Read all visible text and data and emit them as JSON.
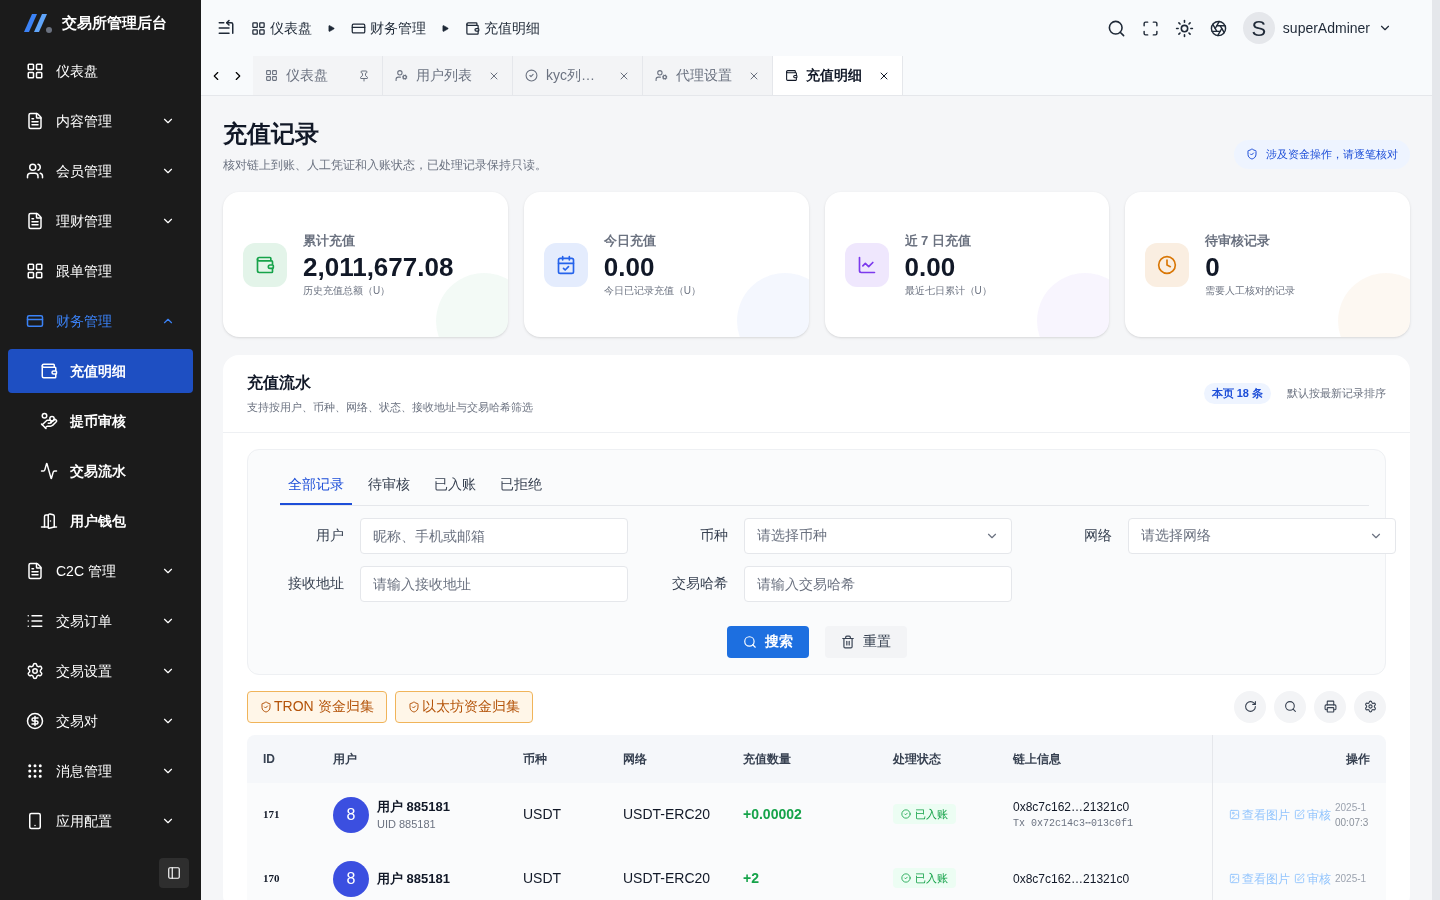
{
  "brand": {
    "title": "交易所管理后台"
  },
  "sidebar": {
    "items": [
      {
        "label": "仪表盘",
        "kind": "link",
        "selected": false
      },
      {
        "label": "内容管理",
        "kind": "group",
        "expanded": false,
        "selected": false
      },
      {
        "label": "会员管理",
        "kind": "group",
        "expanded": false,
        "selected": false
      },
      {
        "label": "理财管理",
        "kind": "group",
        "expanded": false,
        "selected": false
      },
      {
        "label": "跟单管理",
        "kind": "link",
        "selected": false
      },
      {
        "label": "财务管理",
        "kind": "group",
        "expanded": true,
        "selected": true,
        "children": [
          {
            "label": "充值明细",
            "selected": true
          },
          {
            "label": "提币审核",
            "selected": false
          },
          {
            "label": "交易流水",
            "selected": false
          },
          {
            "label": "用户钱包",
            "selected": false
          }
        ]
      },
      {
        "label": "C2C 管理",
        "kind": "group",
        "expanded": false,
        "selected": false
      },
      {
        "label": "交易订单",
        "kind": "group",
        "expanded": false,
        "selected": false
      },
      {
        "label": "交易设置",
        "kind": "group",
        "expanded": false,
        "selected": false
      },
      {
        "label": "交易对",
        "kind": "group",
        "expanded": false,
        "selected": false
      },
      {
        "label": "消息管理",
        "kind": "group",
        "expanded": false,
        "selected": false
      },
      {
        "label": "应用配置",
        "kind": "group",
        "expanded": false,
        "selected": false
      }
    ]
  },
  "breadcrumb": [
    {
      "label": "仪表盘"
    },
    {
      "label": "财务管理"
    },
    {
      "label": "充值明细"
    }
  ],
  "user": {
    "avatar": "S",
    "name": "superAdminer"
  },
  "tabs": [
    {
      "label": "仪表盘",
      "pinned": true,
      "selected": false
    },
    {
      "label": "用户列表",
      "pinned": false,
      "selected": false
    },
    {
      "label": "kyc列…",
      "pinned": false,
      "selected": false
    },
    {
      "label": "代理设置",
      "pinned": false,
      "selected": false
    },
    {
      "label": "充值明细",
      "pinned": false,
      "selected": true
    }
  ],
  "page": {
    "title": "充值记录",
    "subtitle": "核对链上到账、人工凭证和入账状态，已处理记录保持只读。",
    "notice": "涉及资金操作，请逐笔核对"
  },
  "stats": [
    {
      "label": "累计充值",
      "value": "2,011,677.08",
      "caption": "历史充值总额（U）",
      "color": "#16a34a"
    },
    {
      "label": "今日充值",
      "value": "0.00",
      "caption": "今日已记录充值（U）",
      "color": "#2563eb"
    },
    {
      "label": "近 7 日充值",
      "value": "0.00",
      "caption": "最近七日累计（U）",
      "color": "#7c3aed"
    },
    {
      "label": "待审核记录",
      "value": "0",
      "caption": "需要人工核对的记录",
      "color": "#d97706"
    }
  ],
  "panel": {
    "title": "充值流水",
    "subtitle": "支持按用户、币种、网络、状态、接收地址与交易哈希筛选",
    "count": "本页 18 条",
    "sort_note": "默认按最新记录排序"
  },
  "filter_tabs": [
    {
      "label": "全部记录",
      "selected": true
    },
    {
      "label": "待审核",
      "selected": false
    },
    {
      "label": "已入账",
      "selected": false
    },
    {
      "label": "已拒绝",
      "selected": false
    }
  ],
  "filters": [
    {
      "label": "用户",
      "placeholder": "昵称、手机或邮箱",
      "kind": "input"
    },
    {
      "label": "币种",
      "placeholder": "请选择币种",
      "kind": "select"
    },
    {
      "label": "网络",
      "placeholder": "请选择网络",
      "kind": "select"
    },
    {
      "label": "接收地址",
      "placeholder": "请输入接收地址",
      "kind": "input"
    },
    {
      "label": "交易哈希",
      "placeholder": "请输入交易哈希",
      "kind": "input"
    }
  ],
  "actions": {
    "search": "搜索",
    "reset": "重置"
  },
  "collect_buttons": [
    "TRON 资金归集",
    "以太坊资金归集"
  ],
  "table": {
    "columns": [
      "ID",
      "用户",
      "币种",
      "网络",
      "充值数量",
      "处理状态",
      "链上信息",
      "操作"
    ],
    "rows": [
      {
        "id": "171",
        "avatar": "8",
        "user": "用户 885181",
        "uid": "UID 885181",
        "coin": "USDT",
        "network": "USDT-ERC20",
        "amount": "+0.00002",
        "status": "已入账",
        "address": "0x8c7c162…21321c0",
        "tx": "Tx 0x72c14c3⋯013c0f1",
        "view": "查看图片",
        "review": "审核",
        "time": "2025-1",
        "time2": "00:07:3"
      },
      {
        "id": "170",
        "avatar": "8",
        "user": "用户 885181",
        "coin": "USDT",
        "network": "USDT-ERC20",
        "amount": "+2",
        "status": "已入账",
        "address": "0x8c7c162…21321c0",
        "view": "查看图片",
        "review": "审核",
        "time": "2025-1"
      }
    ]
  }
}
